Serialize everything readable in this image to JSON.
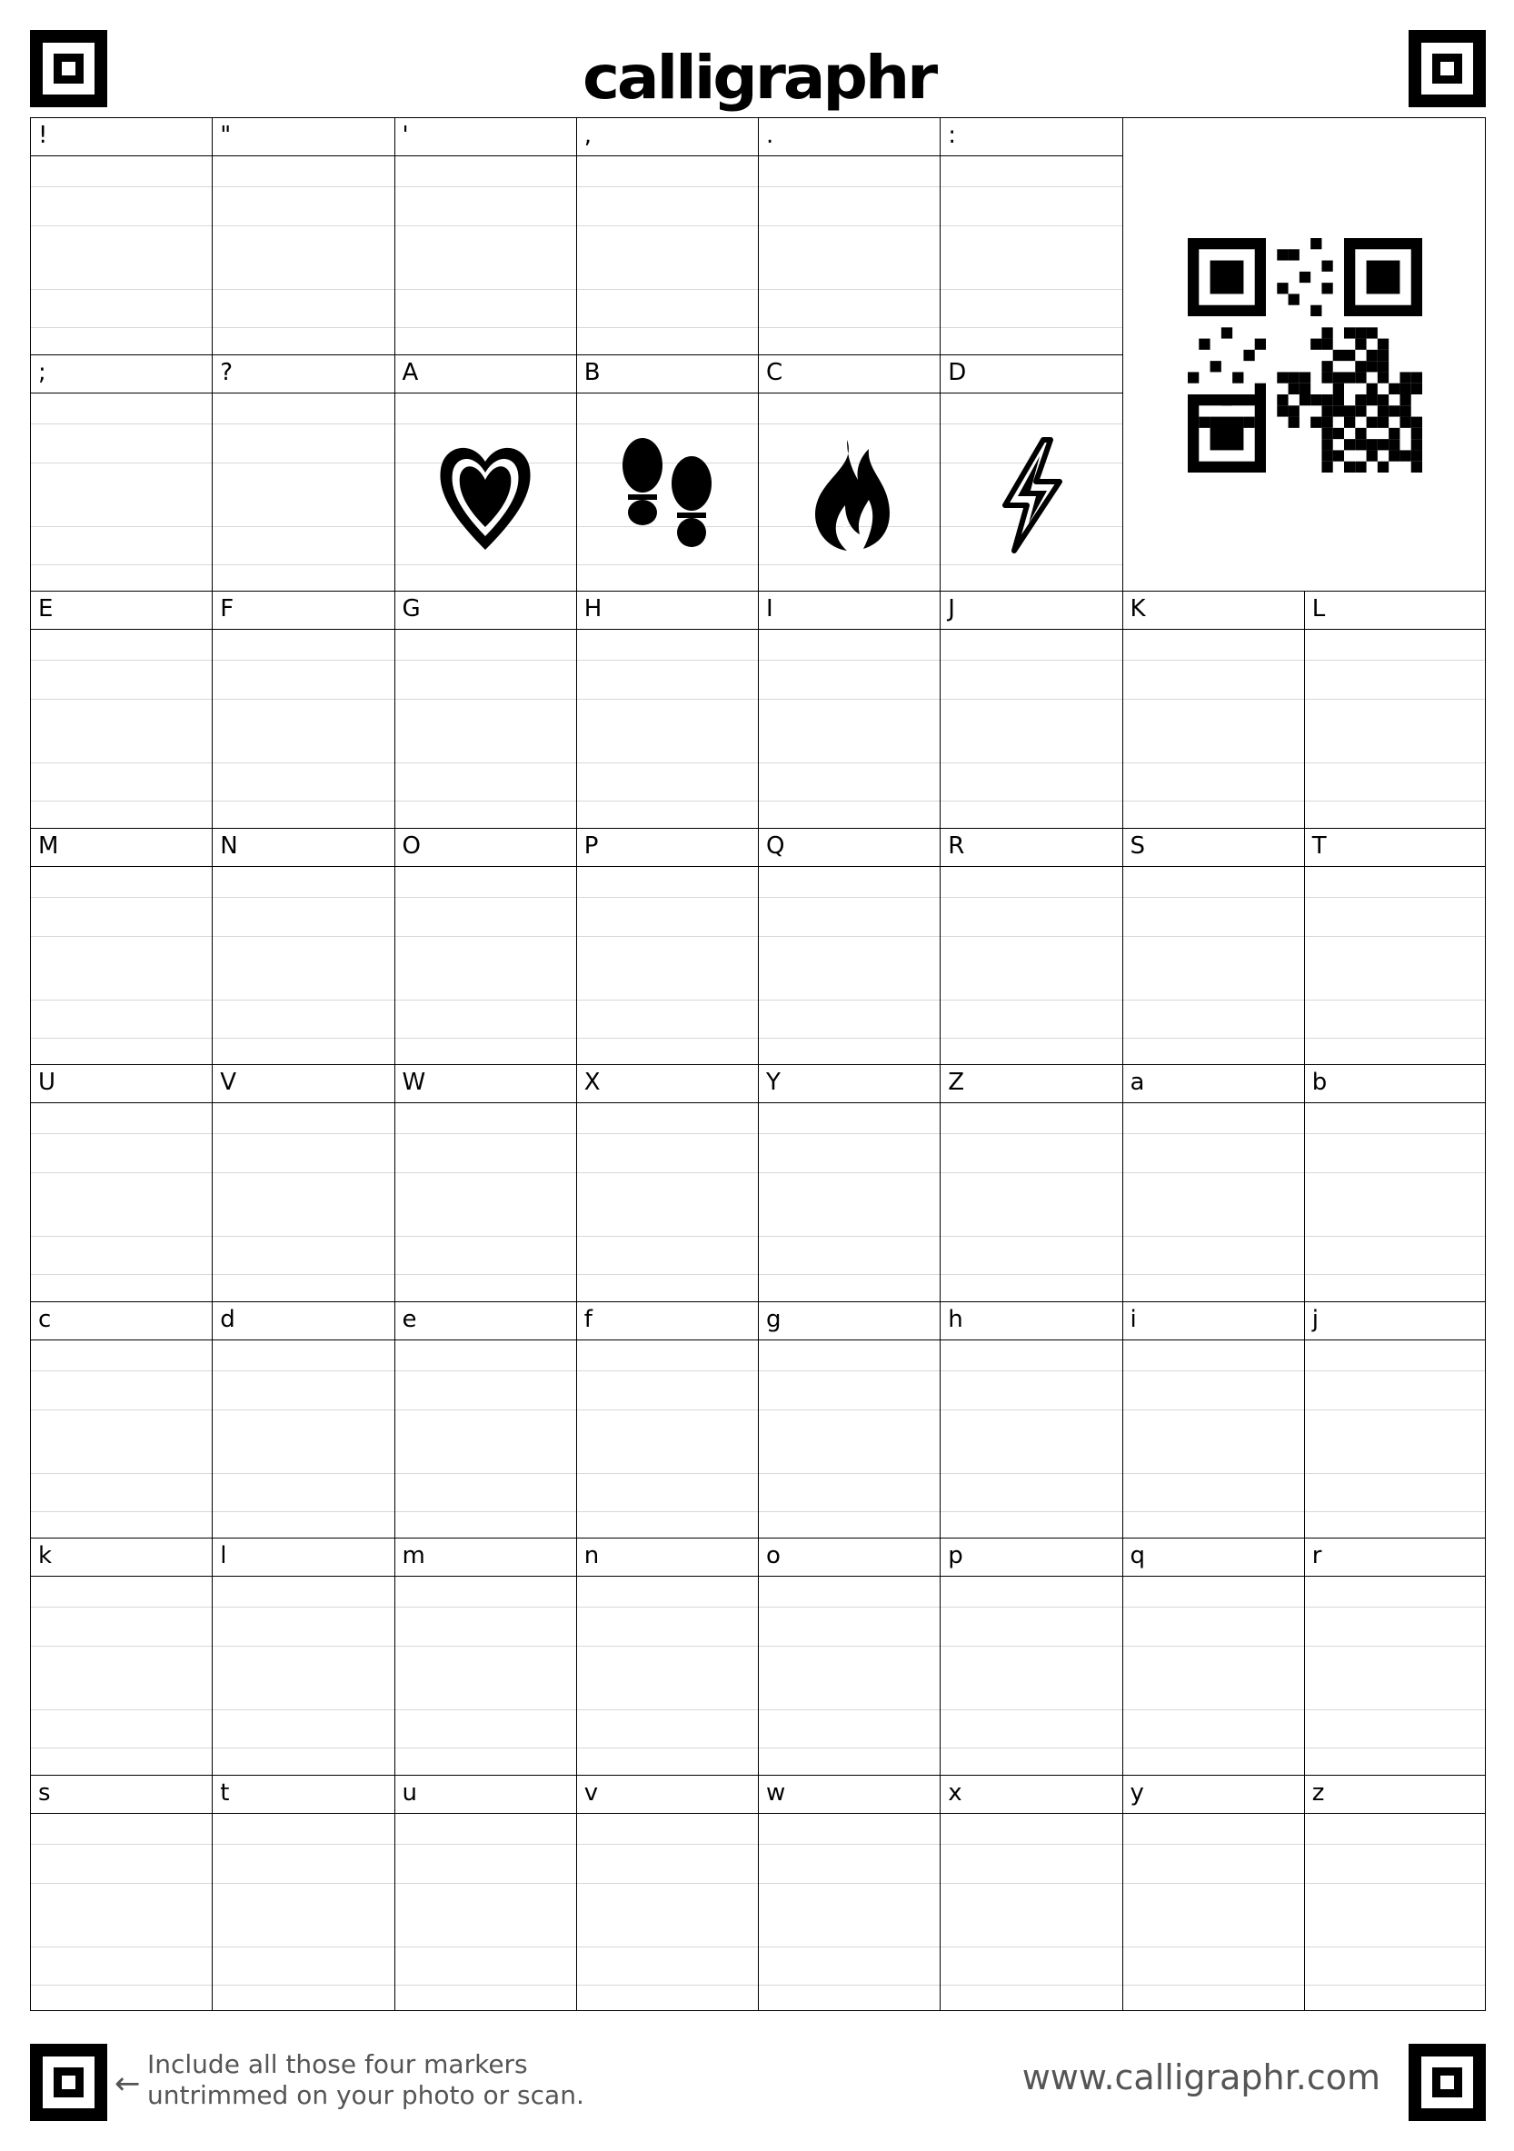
{
  "brand": {
    "logo_text": "calligraphr",
    "url": "www.calligraphr.com"
  },
  "instructions": {
    "arrow": "←",
    "line1": "Include all those four markers",
    "line2": "untrimmed on your photo or scan."
  },
  "rows": [
    {
      "labels": [
        "!",
        "\"",
        "'",
        ",",
        ".",
        ":"
      ]
    },
    {
      "labels": [
        ";",
        "?",
        "A",
        "B",
        "C",
        "D"
      ],
      "glyphs": [
        "",
        "",
        "heart-icon",
        "footprints-icon",
        "flame-icon",
        "lightning-icon"
      ]
    },
    {
      "labels": [
        "E",
        "F",
        "G",
        "H",
        "I",
        "J",
        "K",
        "L"
      ]
    },
    {
      "labels": [
        "M",
        "N",
        "O",
        "P",
        "Q",
        "R",
        "S",
        "T"
      ]
    },
    {
      "labels": [
        "U",
        "V",
        "W",
        "X",
        "Y",
        "Z",
        "a",
        "b"
      ]
    },
    {
      "labels": [
        "c",
        "d",
        "e",
        "f",
        "g",
        "h",
        "i",
        "j"
      ]
    },
    {
      "labels": [
        "k",
        "l",
        "m",
        "n",
        "o",
        "p",
        "q",
        "r"
      ]
    },
    {
      "labels": [
        "s",
        "t",
        "u",
        "v",
        "w",
        "x",
        "y",
        "z"
      ]
    }
  ]
}
